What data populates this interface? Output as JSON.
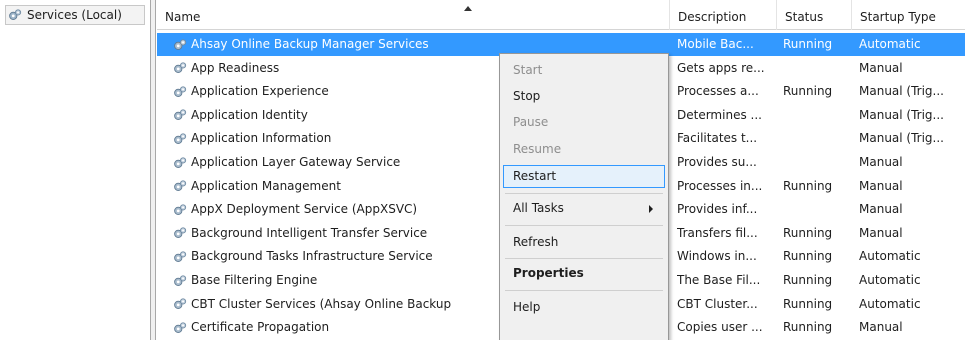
{
  "tree": {
    "root_label": "Services (Local)",
    "root_icon": "services-gear-icon"
  },
  "columns": {
    "name": "Name",
    "description": "Description",
    "status": "Status",
    "startup_type": "Startup Type"
  },
  "services": [
    {
      "name": "Ahsay Online Backup Manager Services",
      "description": "Mobile Bac...",
      "status": "Running",
      "startup": "Automatic",
      "selected": true
    },
    {
      "name": "App Readiness",
      "description": "Gets apps re...",
      "status": "",
      "startup": "Manual"
    },
    {
      "name": "Application Experience",
      "description": "Processes a...",
      "status": "Running",
      "startup": "Manual (Trig..."
    },
    {
      "name": "Application Identity",
      "description": "Determines ...",
      "status": "",
      "startup": "Manual (Trig..."
    },
    {
      "name": "Application Information",
      "description": "Facilitates t...",
      "status": "",
      "startup": "Manual (Trig..."
    },
    {
      "name": "Application Layer Gateway Service",
      "description": "Provides su...",
      "status": "",
      "startup": "Manual"
    },
    {
      "name": "Application Management",
      "description": "Processes in...",
      "status": "Running",
      "startup": "Manual"
    },
    {
      "name": "AppX Deployment Service (AppXSVC)",
      "description": "Provides inf...",
      "status": "",
      "startup": "Manual"
    },
    {
      "name": "Background Intelligent Transfer Service",
      "description": "Transfers fil...",
      "status": "Running",
      "startup": "Manual"
    },
    {
      "name": "Background Tasks Infrastructure Service",
      "description": "Windows in...",
      "status": "Running",
      "startup": "Automatic"
    },
    {
      "name": "Base Filtering Engine",
      "description": "The Base Fil...",
      "status": "Running",
      "startup": "Automatic"
    },
    {
      "name": "CBT Cluster Services (Ahsay Online Backup",
      "description": "CBT Cluster...",
      "status": "Running",
      "startup": "Automatic"
    },
    {
      "name": "Certificate Propagation",
      "description": "Copies user ...",
      "status": "Running",
      "startup": "Manual"
    }
  ],
  "context_menu": {
    "start": "Start",
    "stop": "Stop",
    "pause": "Pause",
    "resume": "Resume",
    "restart": "Restart",
    "all_tasks": "All Tasks",
    "refresh": "Refresh",
    "properties": "Properties",
    "help": "Help"
  },
  "colors": {
    "selection": "#3399ff",
    "menu_bg": "#f0f0f0",
    "menu_hover_border": "#3399ff",
    "disabled_text": "#8e8e8e"
  }
}
